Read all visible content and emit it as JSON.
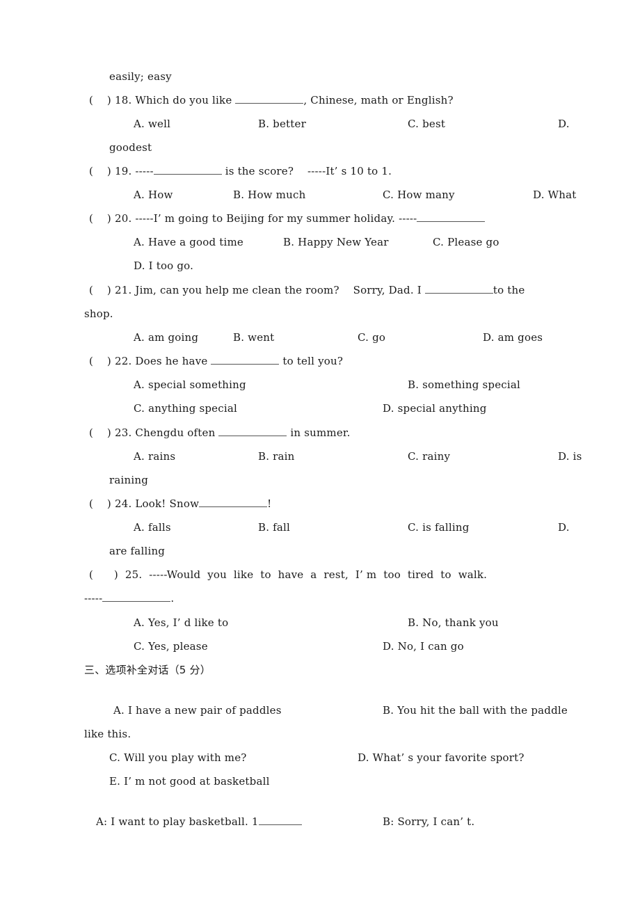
{
  "page": {
    "carryover": "easily; easy",
    "questions": [
      {
        "bracket": "(    )",
        "number": "18.",
        "stem_before": "Which do you like",
        "stem_after": ", Chinese, math or English?",
        "options": [
          "A. well",
          "B. better",
          "C. best",
          "D."
        ],
        "wrap": "goodest"
      },
      {
        "bracket": "(    )",
        "number": "19.",
        "stem_before": "-----",
        "stem_after": " is the score?    -----It’ s 10 to 1.",
        "options": [
          "A. How",
          "B. How much",
          "C. How many",
          "D. What"
        ]
      },
      {
        "bracket": "(    )",
        "number": "20.",
        "stem_before": "-----I’ m going to Beijing for my summer holiday. -----",
        "stem_after": "",
        "options": [
          "A. Have a good time",
          "B. Happy New Year",
          "C. Please go",
          "D. I too go."
        ]
      },
      {
        "bracket": "(    )",
        "number": "21.",
        "stem_before": "Jim, can you help me clean the room?    Sorry, Dad. I ",
        "stem_after": "to the",
        "wrap_stem": "shop.",
        "options": [
          "A. am going",
          "B. went",
          "C. go",
          "D. am goes"
        ]
      },
      {
        "bracket": "(    )",
        "number": "22.",
        "stem_before": "Does he have ",
        "stem_after": " to tell you?",
        "options": [
          "A. special something",
          "B. something special",
          "C. anything special",
          "D. special anything"
        ]
      },
      {
        "bracket": "(    )",
        "number": "23.",
        "stem_before": "Chengdu often ",
        "stem_after": " in summer.",
        "options": [
          "A. rains",
          "B. rain",
          "C. rainy",
          "D. is"
        ],
        "wrap": "raining"
      },
      {
        "bracket": "(    )",
        "number": "24.",
        "stem_before": "Look! Snow",
        "stem_after": "!",
        "options": [
          "A. falls",
          "B. fall",
          "C. is falling",
          "D."
        ],
        "wrap": "are falling"
      },
      {
        "bracket": "(      )",
        "number": "25.",
        "stem_before": "-----Would  you  like  to  have  a  rest,  I’ m  too  tired  to  walk.",
        "wrap_before": "-----",
        "wrap_after": ".",
        "options": [
          "A. Yes, I’ d like to",
          "B. No, thank you",
          "C. Yes, please",
          "D. No, I can go"
        ]
      }
    ],
    "section3": {
      "heading": "三、选项补全对话（5 分）",
      "options": [
        "A. I have a new pair of paddles",
        "B. You hit the ball with the paddle",
        "like this.",
        "C. Will you play with me?",
        "D. What’ s your favorite sport?",
        "E. I’ m not good at basketball"
      ],
      "dialogue": {
        "a_line": "A: I want to play basketball. 1",
        "b_line": "B: Sorry, I can’ t."
      }
    }
  }
}
